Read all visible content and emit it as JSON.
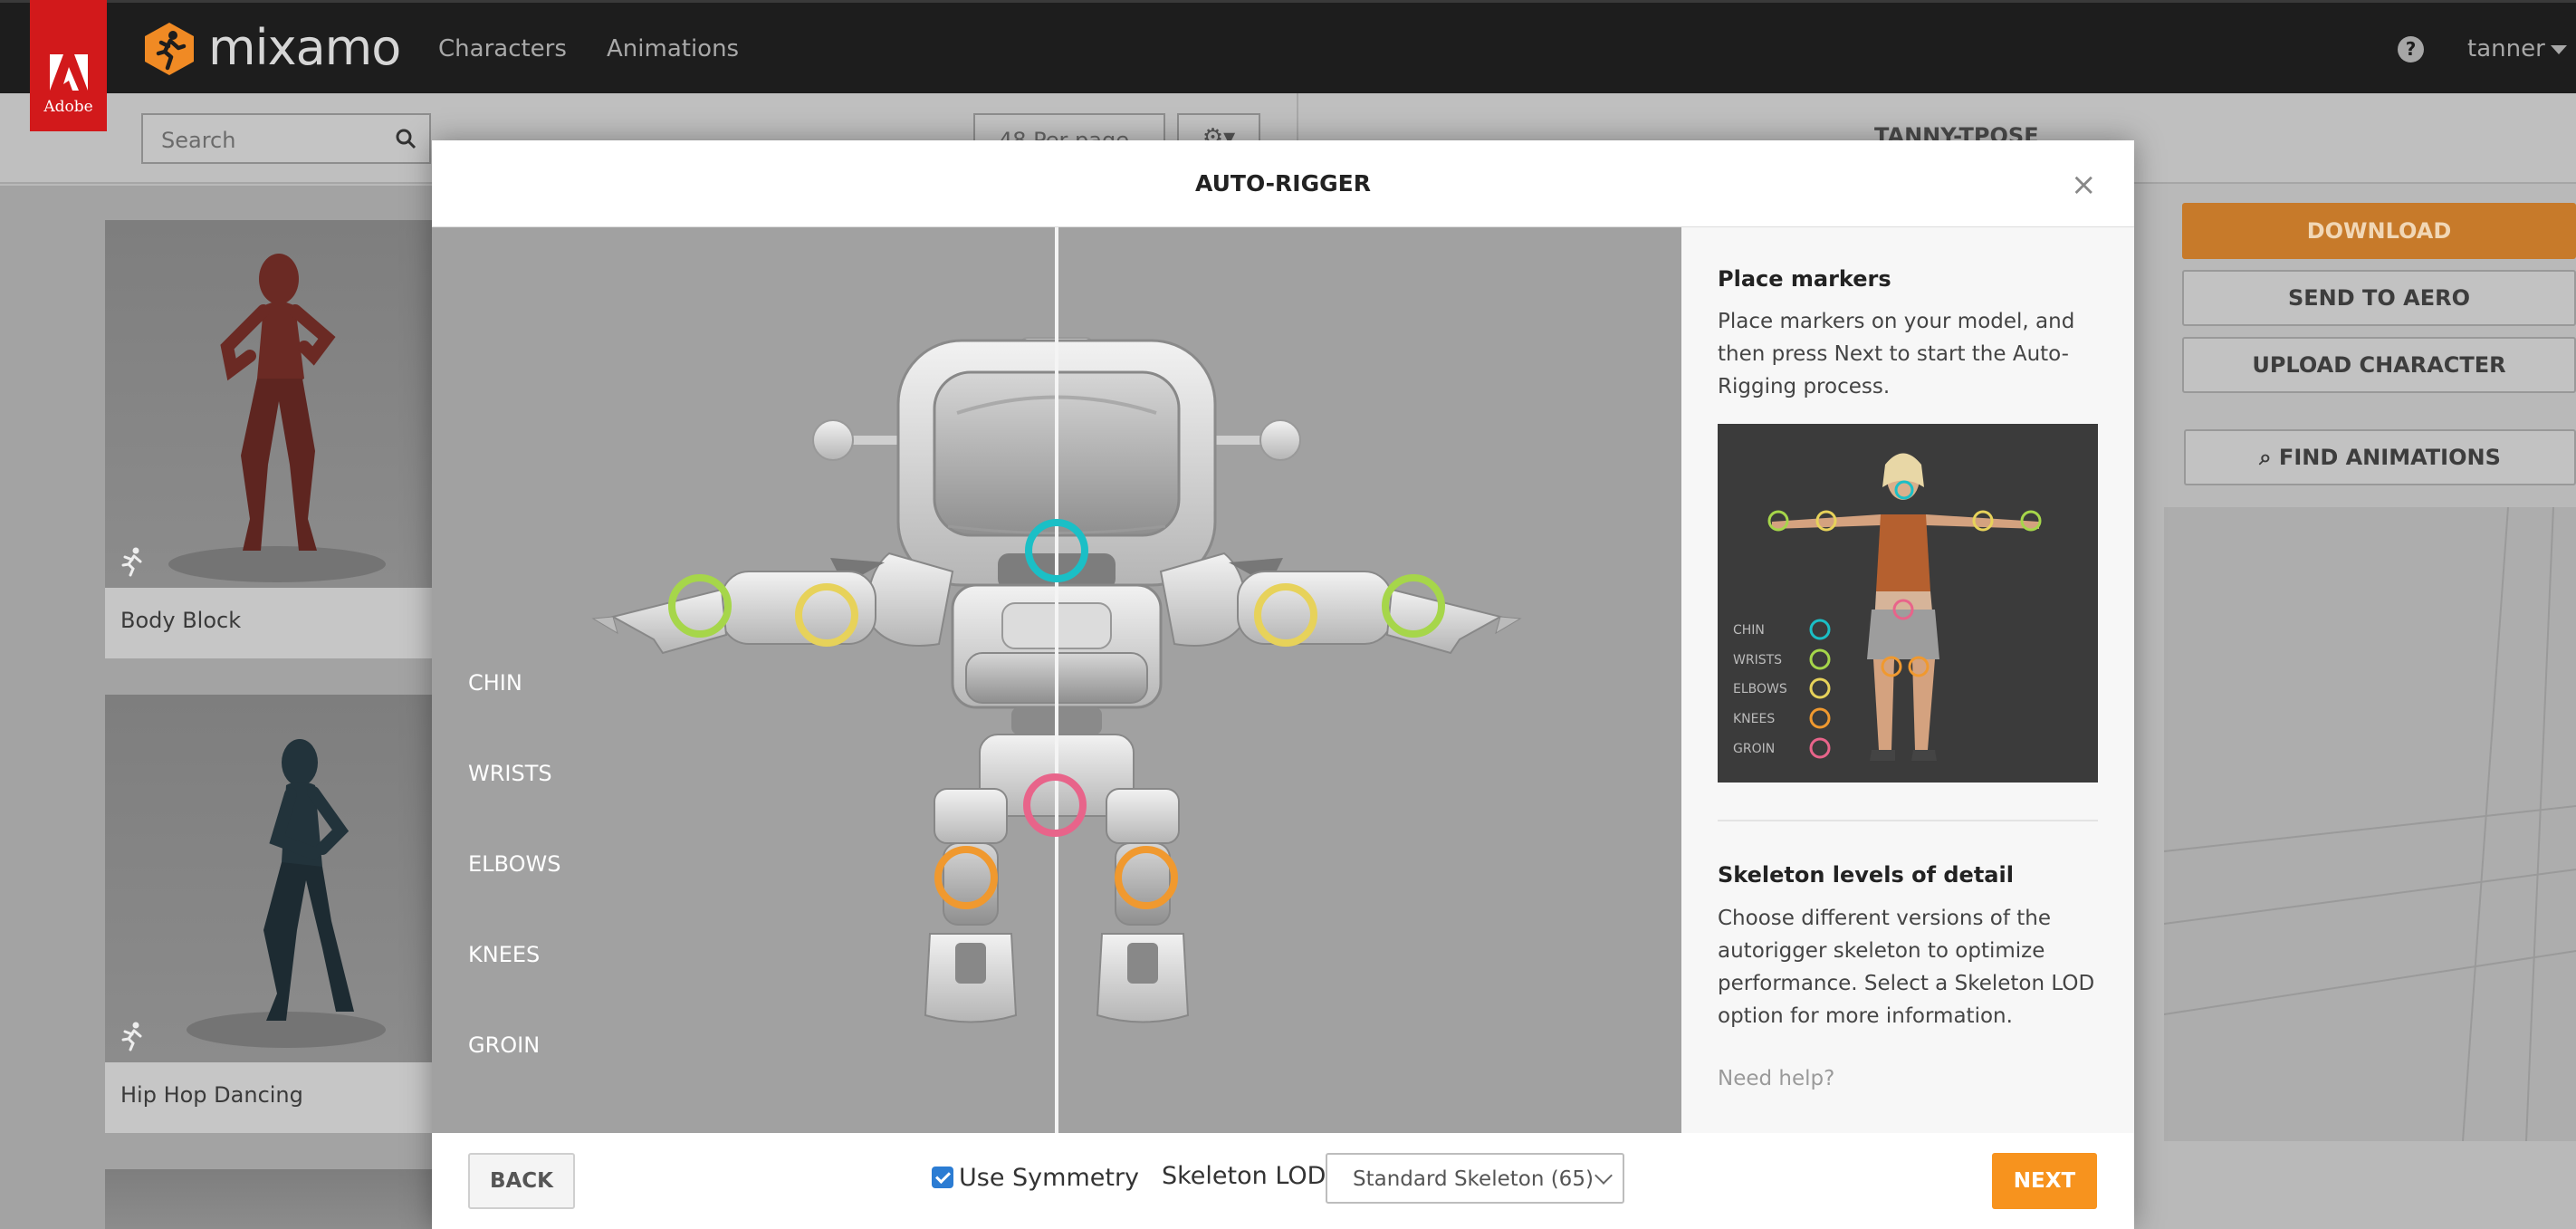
{
  "app": {
    "adobe_label": "Adobe",
    "brand": "mixamo",
    "nav": [
      "Characters",
      "Animations"
    ],
    "help_glyph": "?",
    "user": "tanner"
  },
  "background": {
    "search_placeholder": "Search",
    "per_page": "48 Per page",
    "character_title": "TANNY-TPOSE",
    "cards": [
      {
        "label": "Body Block"
      },
      {
        "label": "Hip Hop Dancing"
      }
    ],
    "buttons": {
      "download": "DOWNLOAD",
      "send_to_aero": "SEND TO AERO",
      "upload_character": "UPLOAD CHARACTER",
      "find_animations": "FIND ANIMATIONS"
    }
  },
  "modal": {
    "title": "AUTO-RIGGER",
    "close_glyph": "×",
    "marker_labels": [
      "CHIN",
      "WRISTS",
      "ELBOWS",
      "KNEES",
      "GROIN"
    ],
    "marker_colors": {
      "chin": "#1bbfc6",
      "wrists": "#a6d64a",
      "elbows": "#e7d25a",
      "knees": "#f0992f",
      "groin": "#e8648a"
    },
    "side": {
      "place_markers_title": "Place markers",
      "place_markers_text": "Place markers on your model, and then press Next to start the Auto-Rigging process.",
      "preview_labels": [
        "CHIN",
        "WRISTS",
        "ELBOWS",
        "KNEES",
        "GROIN"
      ],
      "skeleton_title": "Skeleton levels of detail",
      "skeleton_text": "Choose different versions of the autorigger skeleton to optimize performance. Select a Skeleton LOD option for more information.",
      "help_link": "Need help?"
    },
    "footer": {
      "back": "BACK",
      "use_symmetry": "Use Symmetry",
      "use_symmetry_checked": true,
      "skeleton_lod_label": "Skeleton LOD",
      "skeleton_lod_value": "Standard Skeleton (65)",
      "next": "NEXT"
    }
  },
  "colors": {
    "accent_orange": "#f7931e",
    "adobe_red": "#d2191b",
    "nav_bg": "#1d1d1d"
  }
}
